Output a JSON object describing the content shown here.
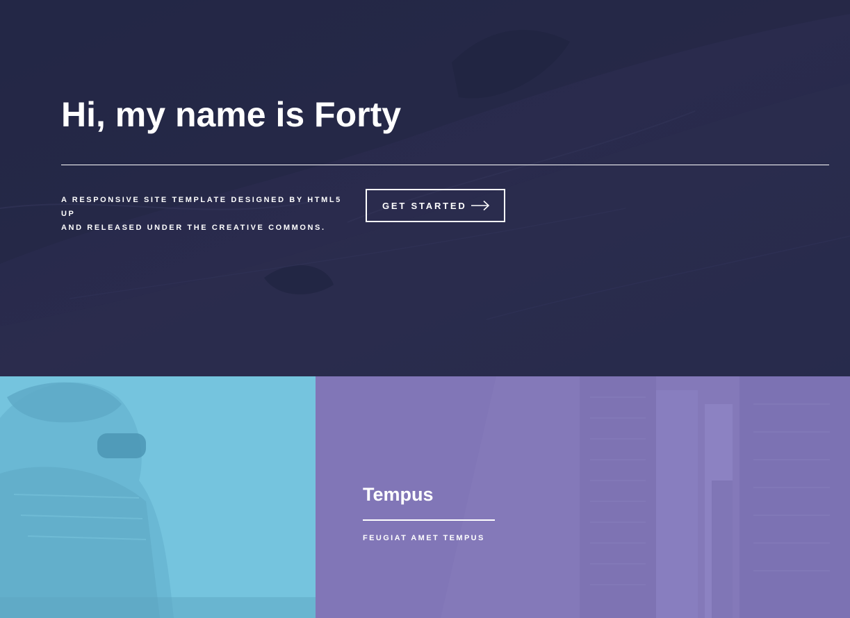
{
  "colors": {
    "banner_overlay": "#242943",
    "tile_left": "#6fc3df",
    "tile_right": "#8d82c4",
    "text": "#ffffff"
  },
  "banner": {
    "title": "Hi, my name is Forty",
    "description_line1": "A responsive site template designed by HTML5 UP",
    "description_line2": "and released under the Creative Commons.",
    "cta_label": "Get Started",
    "cta_icon": "arrow-right-icon"
  },
  "tiles": [
    {
      "title": "",
      "subtitle": ""
    },
    {
      "title": "Tempus",
      "subtitle": "feugiat amet tempus"
    }
  ]
}
